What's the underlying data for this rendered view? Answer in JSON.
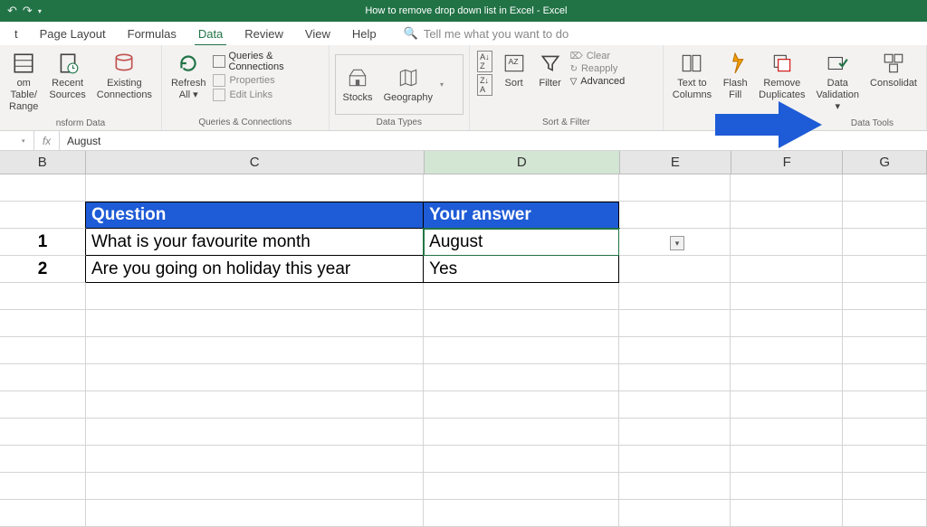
{
  "app": {
    "title": "How to remove drop down list in Excel  -  Excel"
  },
  "ribbon": {
    "tabs": [
      "t",
      "Page Layout",
      "Formulas",
      "Data",
      "Review",
      "View",
      "Help"
    ],
    "active_tab": "Data",
    "tell_me": "Tell me what you want to do",
    "groups": {
      "get_transform": {
        "from_table": "om Table/\nRange",
        "recent": "Recent\nSources",
        "existing": "Existing\nConnections",
        "label": "nsform Data"
      },
      "refresh": {
        "refresh": "Refresh\nAll ▾",
        "queries": "Queries & Connections",
        "properties": "Properties",
        "edit_links": "Edit Links",
        "label": "Queries & Connections"
      },
      "data_types": {
        "stocks": "Stocks",
        "geography": "Geography",
        "label": "Data Types"
      },
      "sort_filter": {
        "sort": "Sort",
        "filter": "Filter",
        "clear": "Clear",
        "reapply": "Reapply",
        "advanced": "Advanced",
        "label": "Sort & Filter"
      },
      "data_tools": {
        "text_to_columns": "Text to\nColumns",
        "flash_fill": "Flash\nFill",
        "remove_duplicates": "Remove\nDuplicates",
        "data_validation": "Data\nValidation ▾",
        "consolidate": "Consolidat",
        "label": "Data Tools"
      }
    }
  },
  "formula_bar": {
    "value": "August"
  },
  "columns": [
    "B",
    "C",
    "D",
    "E",
    "F",
    "G"
  ],
  "table": {
    "headers": {
      "question": "Question",
      "answer": "Your answer"
    },
    "rows": [
      {
        "num": "1",
        "question": "What is your favourite month",
        "answer": "August"
      },
      {
        "num": "2",
        "question": "Are you going on holiday this year",
        "answer": "Yes"
      }
    ]
  },
  "selected_cell": "D3"
}
